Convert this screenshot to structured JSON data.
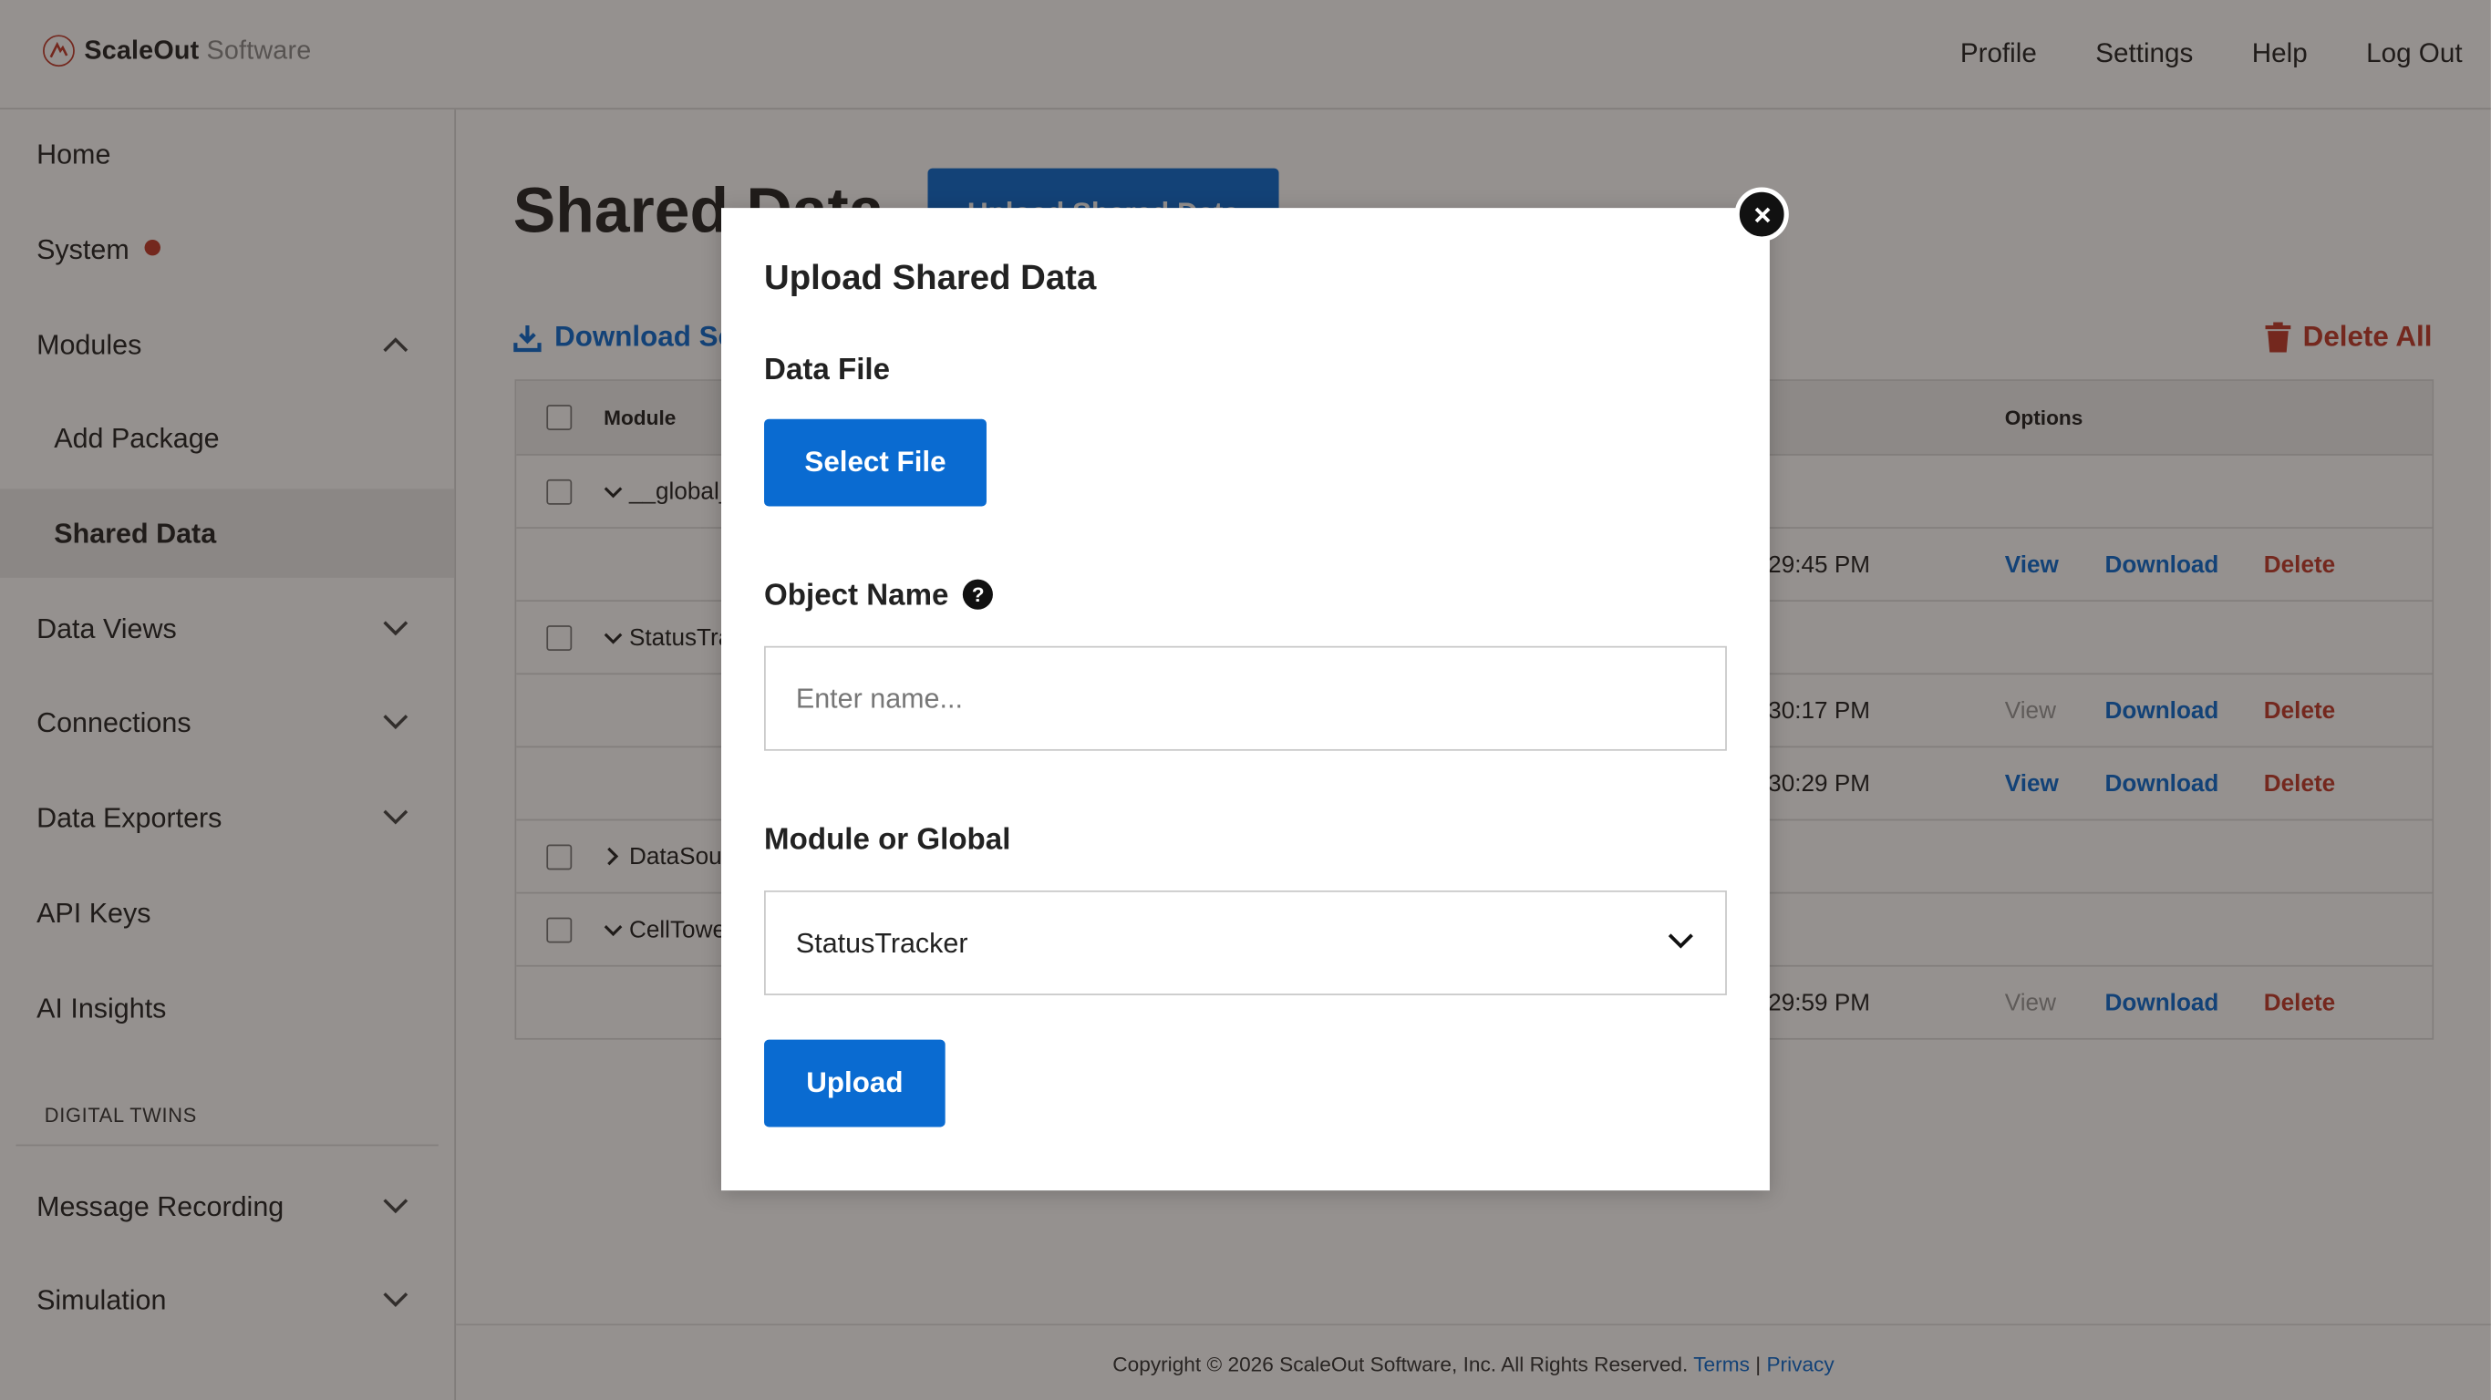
{
  "brand": {
    "name_bold": "ScaleOut",
    "name_light": " Software"
  },
  "topnav": [
    "Profile",
    "Settings",
    "Help",
    "Log Out"
  ],
  "sidebar": {
    "items": [
      {
        "label": "Home"
      },
      {
        "label": "System"
      },
      {
        "label": "Modules"
      },
      {
        "label": "Add Package"
      },
      {
        "label": "Shared Data"
      },
      {
        "label": "Data Views"
      },
      {
        "label": "Connections"
      },
      {
        "label": "Data Exporters"
      },
      {
        "label": "API Keys"
      },
      {
        "label": "AI Insights"
      },
      {
        "label": "Message Recording"
      },
      {
        "label": "Simulation"
      }
    ],
    "section_label": "DIGITAL TWINS"
  },
  "main": {
    "title": "Shared Data",
    "upload_button": "Upload Shared Data",
    "download_link": "Download Schema",
    "delete_all": "Delete All",
    "table": {
      "headers": {
        "module": "Module",
        "options": "Options"
      },
      "rows": [
        {
          "module": "__global__",
          "time": "",
          "view": "",
          "download": "",
          "delete": ""
        },
        {
          "module": "",
          "time": "29:45 PM",
          "view": "View",
          "download": "Download",
          "delete": "Delete"
        },
        {
          "module": "StatusTracker",
          "time": "",
          "view": "",
          "download": "",
          "delete": ""
        },
        {
          "module": "",
          "time": "30:17 PM",
          "view": "View",
          "download": "Download",
          "delete": "Delete"
        },
        {
          "module": "",
          "time": "30:29 PM",
          "view": "View",
          "download": "Download",
          "delete": "Delete"
        },
        {
          "module": "DataSource",
          "time": "",
          "view": "",
          "download": "",
          "delete": ""
        },
        {
          "module": "CellTower",
          "time": "",
          "view": "",
          "download": "",
          "delete": ""
        },
        {
          "module": "",
          "time": "29:59 PM",
          "view": "View",
          "download": "Download",
          "delete": "Delete"
        }
      ]
    }
  },
  "footer": {
    "copyright": "Copyright © 2026 ScaleOut Software, Inc. All Rights Reserved.",
    "terms": "Terms",
    "separator": "|",
    "privacy": "Privacy"
  },
  "modal": {
    "title": "Upload Shared Data",
    "data_file_label": "Data File",
    "select_file_button": "Select File",
    "object_name_label": "Object Name",
    "object_name_help": "?",
    "object_name_placeholder": "Enter name...",
    "module_label": "Module or Global",
    "module_selected": "StatusTracker",
    "upload_button": "Upload"
  },
  "colors": {
    "accent": "#0a6bd1",
    "danger": "#c0392b",
    "overlay": "rgba(30,22,18,0.47)"
  }
}
